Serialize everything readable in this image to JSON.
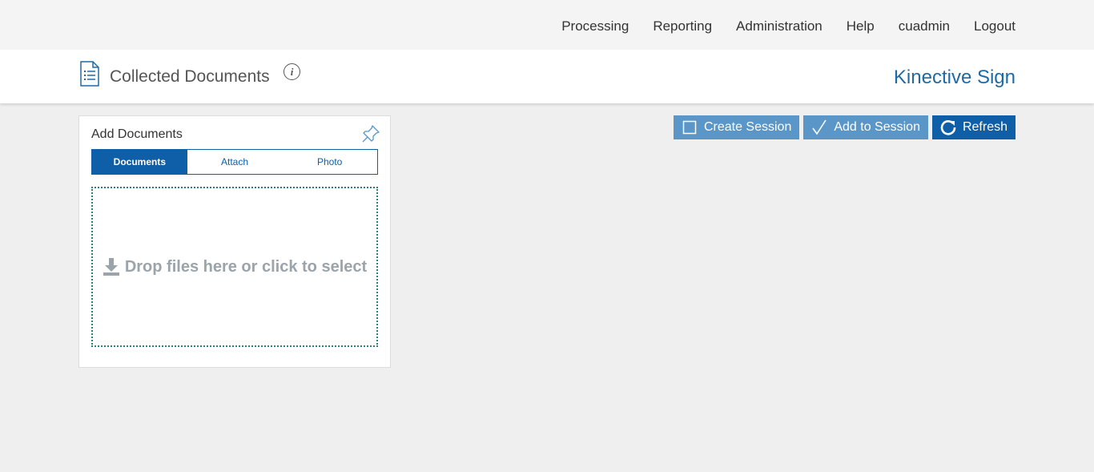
{
  "nav": {
    "items": [
      {
        "label": "Processing"
      },
      {
        "label": "Reporting"
      },
      {
        "label": "Administration"
      },
      {
        "label": "Help"
      },
      {
        "label": "cuadmin"
      },
      {
        "label": "Logout"
      }
    ]
  },
  "header": {
    "title": "Collected Documents",
    "info_glyph": "i",
    "brand": "Kinective Sign"
  },
  "panel": {
    "title": "Add Documents",
    "tabs": [
      {
        "label": "Documents",
        "active": true
      },
      {
        "label": "Attach",
        "active": false
      },
      {
        "label": "Photo",
        "active": false
      }
    ],
    "dropzone_text": "Drop files here or click to select"
  },
  "actions": {
    "create_session": "Create Session",
    "add_to_session": "Add to Session",
    "refresh": "Refresh"
  },
  "colors": {
    "primary": "#0f5ea8",
    "primary_light": "#5a97c8",
    "brand": "#1f6aa5",
    "dropzone_border": "#2a7f7f"
  }
}
